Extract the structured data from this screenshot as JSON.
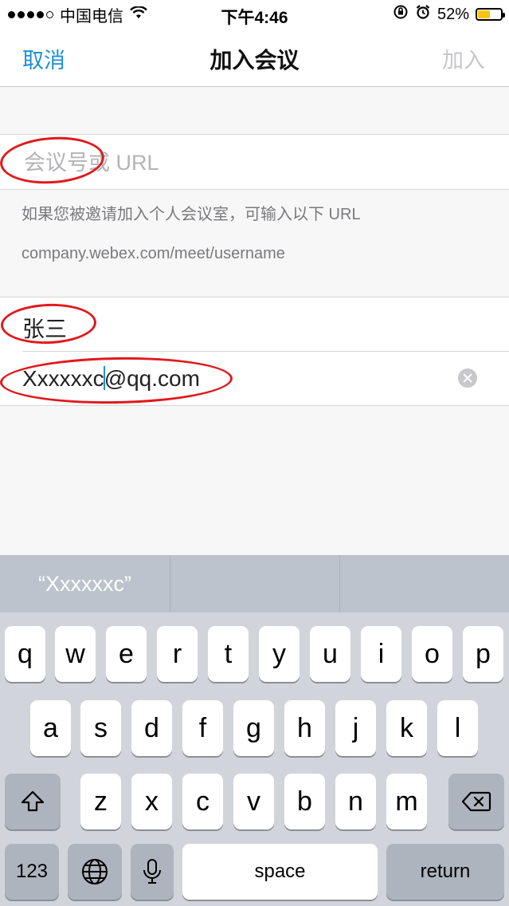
{
  "status_bar": {
    "carrier": "中国电信",
    "time": "下午4:46",
    "battery_percent_label": "52%",
    "battery_level": 0.52
  },
  "nav": {
    "cancel": "取消",
    "title": "加入会议",
    "join": "加入"
  },
  "form": {
    "meeting_placeholder": "会议号或 URL",
    "meeting_value": "",
    "hint_line_1": "如果您被邀请加入个人会议室，可输入以下 URL",
    "hint_line_2": "company.webex.com/meet/username",
    "name_value": "张三",
    "email_before_caret": "Xxxxxxc",
    "email_after_caret": "@qq.com"
  },
  "keyboard": {
    "predictions": [
      "“Xxxxxxc”",
      "",
      ""
    ],
    "row1": [
      "q",
      "w",
      "e",
      "r",
      "t",
      "y",
      "u",
      "i",
      "o",
      "p"
    ],
    "row2": [
      "a",
      "s",
      "d",
      "f",
      "g",
      "h",
      "j",
      "k",
      "l"
    ],
    "row3": [
      "z",
      "x",
      "c",
      "v",
      "b",
      "n",
      "m"
    ],
    "numbers_key": "123",
    "space_key": "space",
    "return_key": "return"
  },
  "colors": {
    "accent": "#1e8fd8",
    "disabled": "#c7c7cc",
    "annotation": "#e0191c",
    "battery": "#f5c518"
  }
}
